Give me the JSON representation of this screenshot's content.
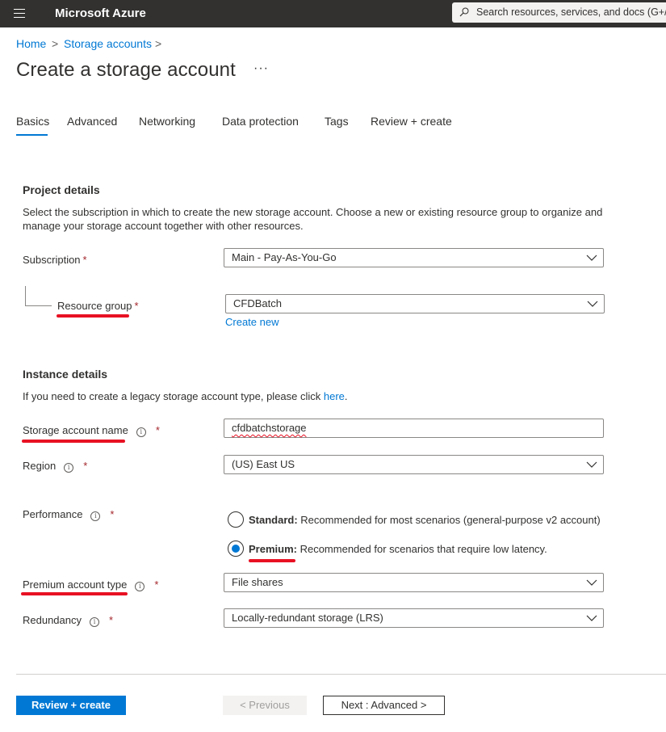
{
  "topbar": {
    "brand": "Microsoft Azure",
    "search_placeholder": "Search resources, services, and docs (G+/)"
  },
  "breadcrumb": {
    "items": [
      "Home",
      "Storage accounts"
    ],
    "separator": ">"
  },
  "page": {
    "title": "Create a storage account",
    "more": "···"
  },
  "tabs": [
    {
      "label": "Basics",
      "active": true
    },
    {
      "label": "Advanced"
    },
    {
      "label": "Networking"
    },
    {
      "label": "Data protection"
    },
    {
      "label": "Tags"
    },
    {
      "label": "Review + create"
    }
  ],
  "project": {
    "heading": "Project details",
    "description_line1": "Select the subscription in which to create the new storage account. Choose a new or existing resource group to organize and",
    "description_line2": "manage your storage account together with other resources.",
    "subscription_label": "Subscription",
    "subscription_value": "Main - Pay-As-You-Go",
    "resource_group_label": "Resource group",
    "resource_group_value": "CFDBatch",
    "create_new": "Create new"
  },
  "instance": {
    "heading": "Instance details",
    "legacy_text": "If you need to create a legacy storage account type, please click ",
    "legacy_link": "here",
    "legacy_period": ".",
    "name_label": "Storage account name",
    "name_value": "cfdbatchstorage",
    "region_label": "Region",
    "region_value": "(US) East US",
    "performance_label": "Performance",
    "standard_title": "Standard:",
    "standard_desc": " Recommended for most scenarios (general-purpose v2 account)",
    "premium_title": "Premium:",
    "premium_desc": " Recommended for scenarios that require low latency.",
    "performance_selected": "Premium",
    "premium_type_label": "Premium account type",
    "premium_type_value": "File shares",
    "redundancy_label": "Redundancy",
    "redundancy_value": "Locally-redundant storage (LRS)"
  },
  "required_mark": "*",
  "info_glyph": "i",
  "footer": {
    "review_create": "Review + create",
    "previous": "< Previous",
    "next": "Next : Advanced >"
  },
  "colors": {
    "accent": "#0078d4",
    "topbar": "#323130",
    "required": "#a4262c",
    "annotation": "#e81123"
  }
}
